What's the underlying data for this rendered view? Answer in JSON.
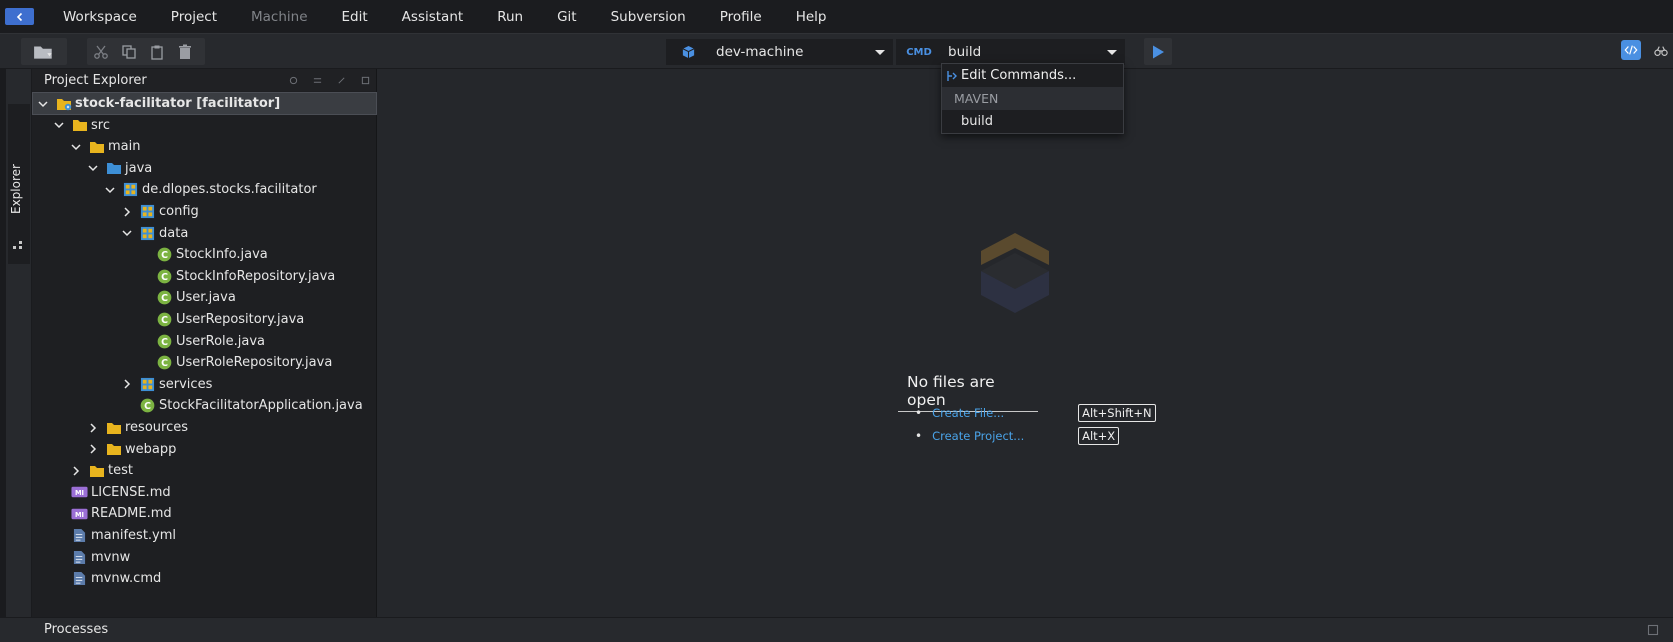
{
  "menu": [
    "Workspace",
    "Project",
    "Machine",
    "Edit",
    "Assistant",
    "Run",
    "Git",
    "Subversion",
    "Profile",
    "Help"
  ],
  "menu_disabled": [
    "Machine"
  ],
  "toolbar": {
    "machine": "dev-machine",
    "cmd_label": "CMD",
    "command": "build"
  },
  "dropdown": {
    "edit_label": "Edit Commands...",
    "section": "MAVEN",
    "item": "build"
  },
  "rail": {
    "explorer_tab": "Explorer"
  },
  "explorer": {
    "title": "Project Explorer",
    "rows": [
      {
        "label": "stock-facilitator [facilitator]",
        "icon": "project-folder-icon",
        "chevron": "down",
        "level": 0
      },
      {
        "label": "src",
        "icon": "folder-icon",
        "chevron": "down",
        "level": 1
      },
      {
        "label": "main",
        "icon": "folder-icon",
        "chevron": "down",
        "level": 2
      },
      {
        "label": "java",
        "icon": "source-folder-icon",
        "chevron": "down",
        "level": 3
      },
      {
        "label": "de.dlopes.stocks.facilitator",
        "icon": "package-icon",
        "chevron": "down",
        "level": 4
      },
      {
        "label": "config",
        "icon": "package-icon",
        "chevron": "right",
        "level": 5
      },
      {
        "label": "data",
        "icon": "package-icon",
        "chevron": "down",
        "level": 5
      },
      {
        "label": "StockInfo.java",
        "icon": "java-class-icon",
        "chevron": "none",
        "level": 6
      },
      {
        "label": "StockInfoRepository.java",
        "icon": "java-class-icon",
        "chevron": "none",
        "level": 6
      },
      {
        "label": "User.java",
        "icon": "java-class-icon",
        "chevron": "none",
        "level": 6
      },
      {
        "label": "UserRepository.java",
        "icon": "java-class-icon",
        "chevron": "none",
        "level": 6
      },
      {
        "label": "UserRole.java",
        "icon": "java-class-icon",
        "chevron": "none",
        "level": 6
      },
      {
        "label": "UserRoleRepository.java",
        "icon": "java-class-icon",
        "chevron": "none",
        "level": 6
      },
      {
        "label": "services",
        "icon": "package-icon",
        "chevron": "right",
        "level": 5
      },
      {
        "label": "StockFacilitatorApplication.java",
        "icon": "java-class-icon",
        "chevron": "none",
        "level": 5
      },
      {
        "label": "resources",
        "icon": "folder-icon",
        "chevron": "right",
        "level": 3
      },
      {
        "label": "webapp",
        "icon": "folder-icon",
        "chevron": "right",
        "level": 3
      },
      {
        "label": "test",
        "icon": "folder-icon",
        "chevron": "right",
        "level": 2
      },
      {
        "label": "LICENSE.md",
        "icon": "markdown-file-icon",
        "chevron": "none",
        "level": 1
      },
      {
        "label": "README.md",
        "icon": "markdown-file-icon",
        "chevron": "none",
        "level": 1
      },
      {
        "label": "manifest.yml",
        "icon": "file-icon",
        "chevron": "none",
        "level": 1
      },
      {
        "label": "mvnw",
        "icon": "file-icon",
        "chevron": "none",
        "level": 1
      },
      {
        "label": "mvnw.cmd",
        "icon": "file-icon",
        "chevron": "none",
        "level": 1
      }
    ]
  },
  "editor": {
    "empty_title": "No files are open",
    "actions": [
      {
        "label": "Create File...",
        "shortcut": "Alt+Shift+N"
      },
      {
        "label": "Create Project...",
        "shortcut": "Alt+X"
      }
    ]
  },
  "bottom": {
    "processes_label": "Processes"
  },
  "colors": {
    "accent": "#4a90e2",
    "folder": "#e8b41e",
    "source_folder": "#3d8fd6",
    "java_class": "#7cb342",
    "markdown": "#9b6fd6"
  }
}
